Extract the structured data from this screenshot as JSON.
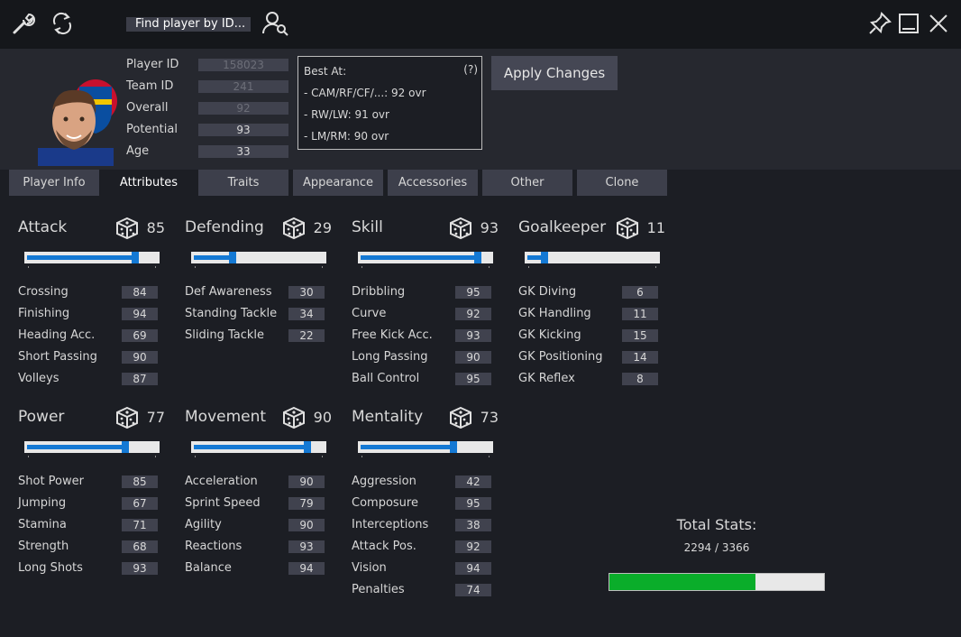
{
  "search": {
    "label": "Find player by ID..."
  },
  "player": {
    "fields": [
      {
        "label": "Player ID",
        "value": "158023",
        "editable": false
      },
      {
        "label": "Team ID",
        "value": "241",
        "editable": false
      },
      {
        "label": "Overall",
        "value": "92",
        "editable": false
      },
      {
        "label": "Potential",
        "value": "93",
        "editable": true
      },
      {
        "label": "Age",
        "value": "33",
        "editable": true
      }
    ]
  },
  "best_at": {
    "title": "Best At:",
    "help": "(?)",
    "lines": [
      "- CAM/RF/CF/...: 92 ovr",
      "- RW/LW: 91 ovr",
      "- LM/RM: 90 ovr"
    ]
  },
  "apply_label": "Apply Changes",
  "tabs": [
    "Player Info",
    "Attributes",
    "Traits",
    "Appearance",
    "Accessories",
    "Other",
    "Clone"
  ],
  "active_tab": 1,
  "categories": [
    {
      "name": "Attack",
      "value": "85",
      "level": 85,
      "stats": [
        [
          "Crossing",
          "84"
        ],
        [
          "Finishing",
          "94"
        ],
        [
          "Heading Acc.",
          "69"
        ],
        [
          "Short Passing",
          "90"
        ],
        [
          "Volleys",
          "87"
        ]
      ]
    },
    {
      "name": "Defending",
      "value": "29",
      "level": 29,
      "stats": [
        [
          "Def Awareness",
          "30"
        ],
        [
          "Standing Tackle",
          "34"
        ],
        [
          "Sliding Tackle",
          "22"
        ]
      ]
    },
    {
      "name": "Skill",
      "value": "93",
      "level": 93,
      "stats": [
        [
          "Dribbling",
          "95"
        ],
        [
          "Curve",
          "92"
        ],
        [
          "Free Kick Acc.",
          "93"
        ],
        [
          "Long Passing",
          "90"
        ],
        [
          "Ball Control",
          "95"
        ]
      ]
    },
    {
      "name": "Goalkeeper",
      "value": "11",
      "level": 11,
      "stats": [
        [
          "GK Diving",
          "6"
        ],
        [
          "GK Handling",
          "11"
        ],
        [
          "GK Kicking",
          "15"
        ],
        [
          "GK Positioning",
          "14"
        ],
        [
          "GK Reflex",
          "8"
        ]
      ]
    },
    {
      "name": "Power",
      "value": "77",
      "level": 77,
      "stats": [
        [
          "Shot Power",
          "85"
        ],
        [
          "Jumping",
          "67"
        ],
        [
          "Stamina",
          "71"
        ],
        [
          "Strength",
          "68"
        ],
        [
          "Long Shots",
          "93"
        ]
      ]
    },
    {
      "name": "Movement",
      "value": "90",
      "level": 90,
      "stats": [
        [
          "Acceleration",
          "90"
        ],
        [
          "Sprint Speed",
          "79"
        ],
        [
          "Agility",
          "90"
        ],
        [
          "Reactions",
          "93"
        ],
        [
          "Balance",
          "94"
        ]
      ]
    },
    {
      "name": "Mentality",
      "value": "73",
      "level": 73,
      "stats": [
        [
          "Aggression",
          "42"
        ],
        [
          "Composure",
          "95"
        ],
        [
          "Interceptions",
          "38"
        ],
        [
          "Attack Pos.",
          "92"
        ],
        [
          "Vision",
          "94"
        ],
        [
          "Penalties",
          "74"
        ]
      ]
    }
  ],
  "total": {
    "title": "Total Stats:",
    "value_text": "2294 / 3366",
    "fraction": 0.6815
  },
  "colors": {
    "accent": "#1479d4",
    "progress": "#0aad2a",
    "background": "#1c1e24"
  }
}
